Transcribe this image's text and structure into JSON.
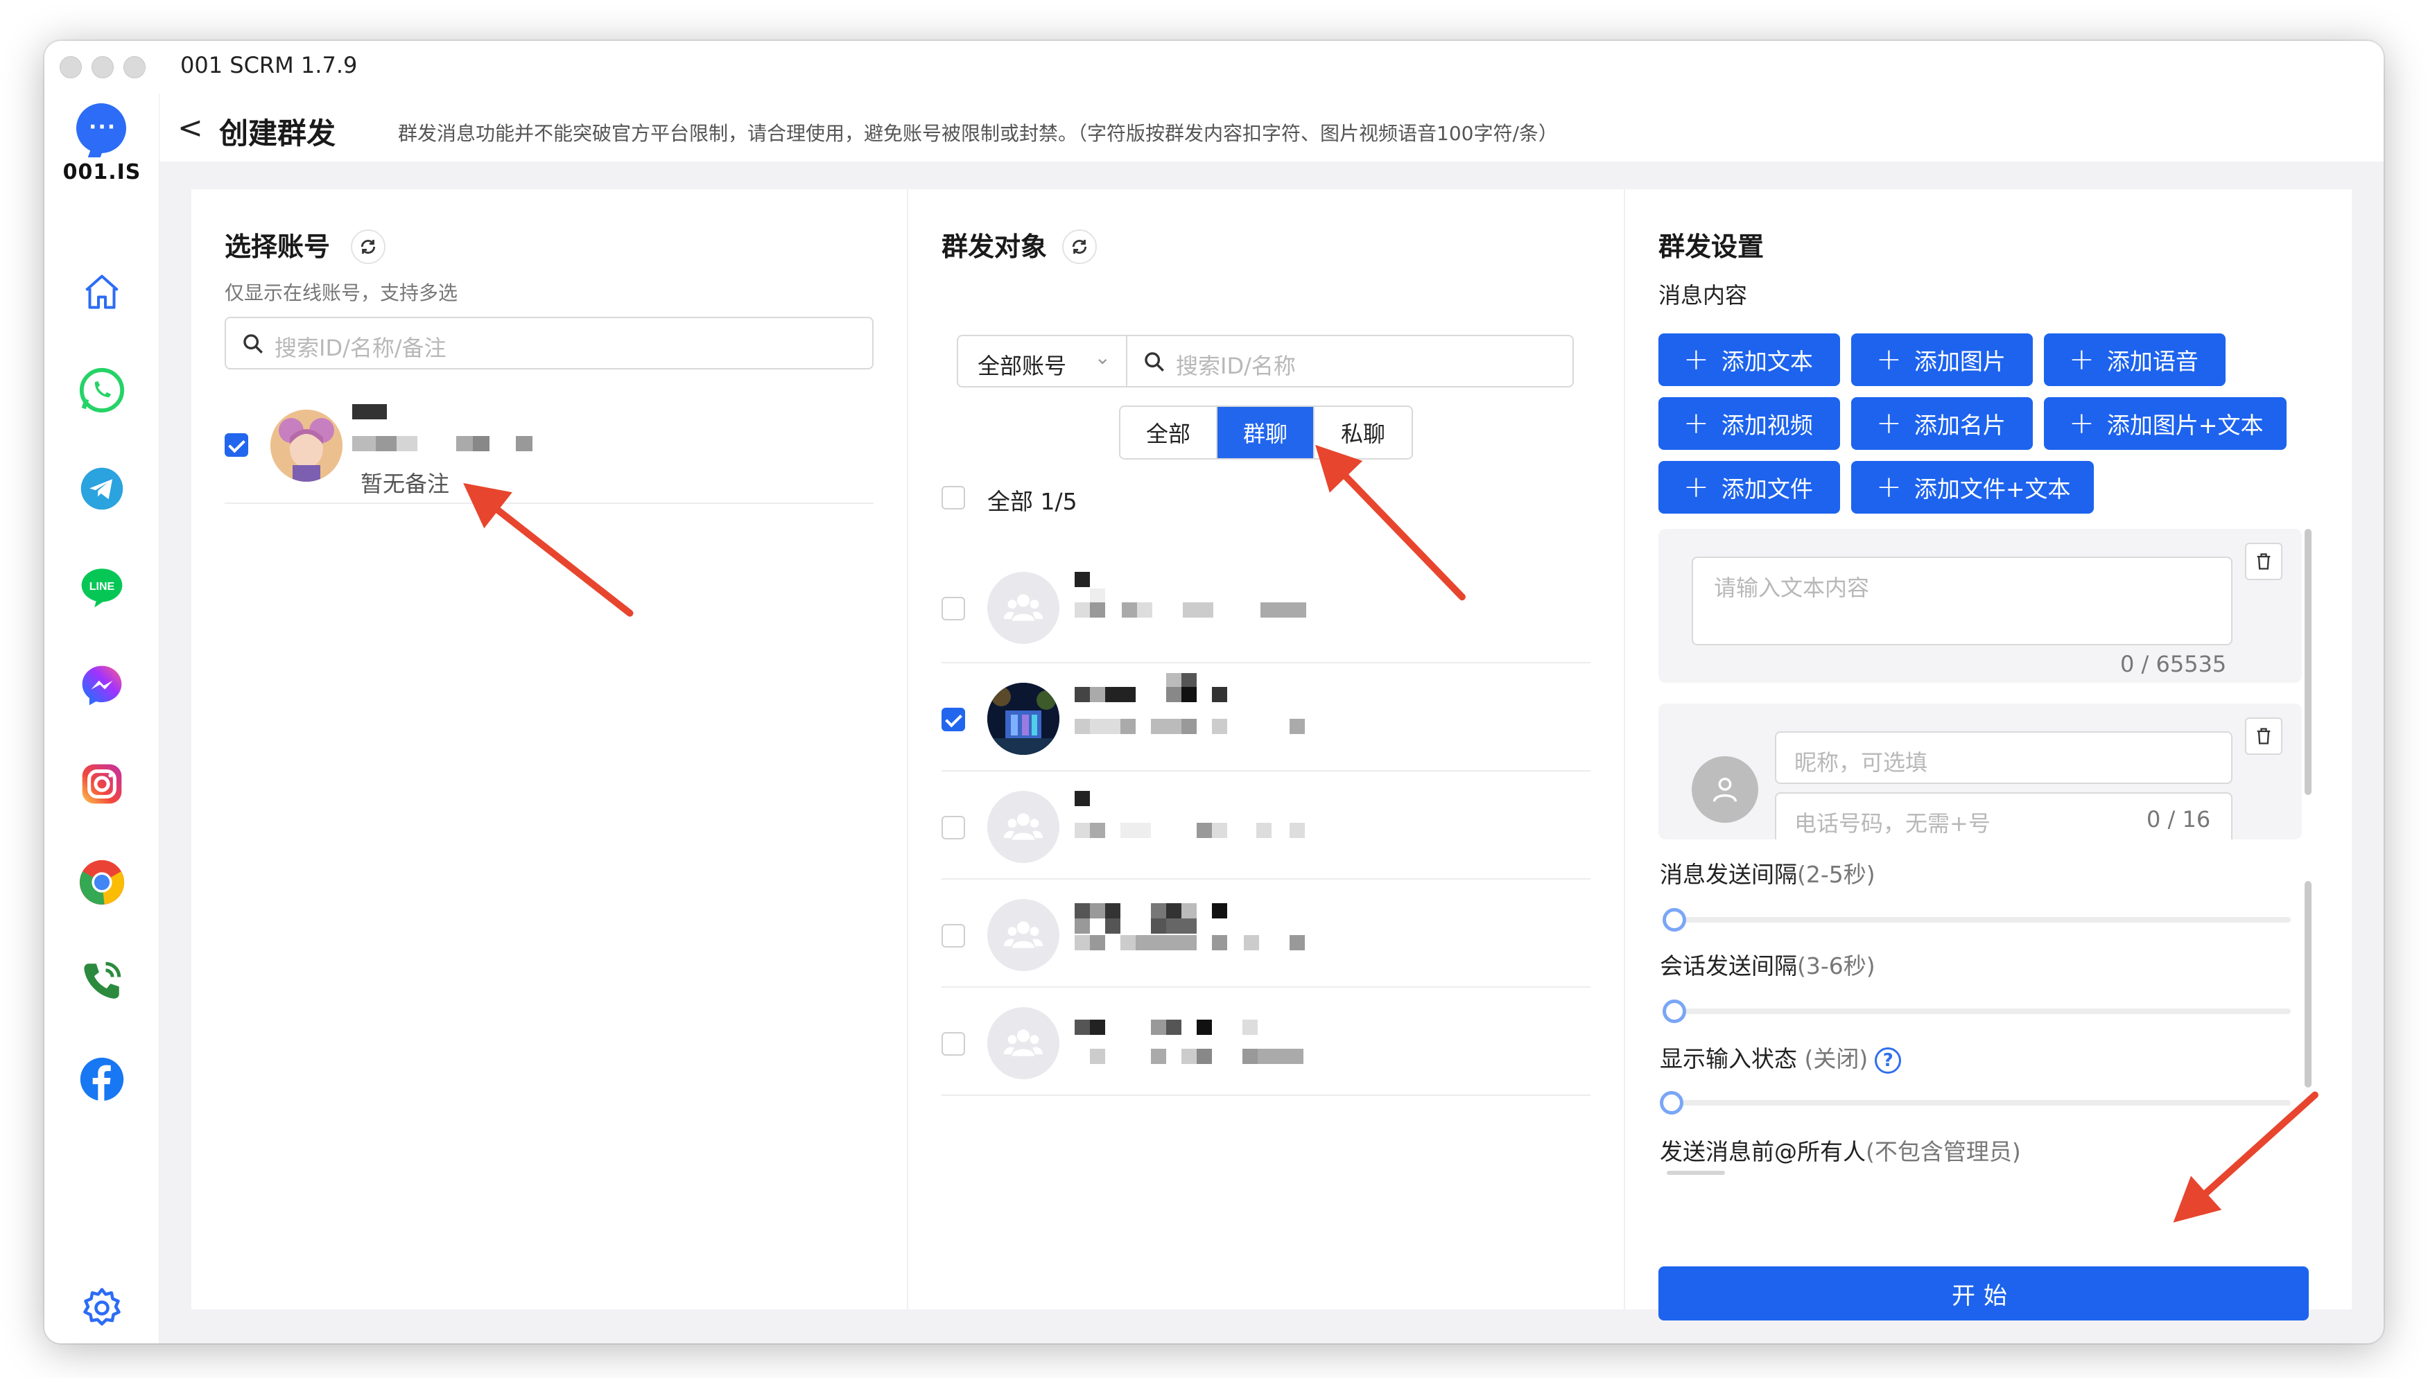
{
  "window": {
    "title": "001 SCRM 1.7.9"
  },
  "logo": {
    "text": "001.IS"
  },
  "sidebar": {
    "items": [
      {
        "name": "home",
        "icon": "home-icon"
      },
      {
        "name": "whatsapp",
        "icon": "whatsapp-icon"
      },
      {
        "name": "telegram",
        "icon": "telegram-icon"
      },
      {
        "name": "line",
        "icon": "line-icon",
        "label": "LINE"
      },
      {
        "name": "messenger",
        "icon": "messenger-icon"
      },
      {
        "name": "instagram",
        "icon": "instagram-icon"
      },
      {
        "name": "chrome",
        "icon": "chrome-icon"
      },
      {
        "name": "phone",
        "icon": "phone-icon"
      },
      {
        "name": "facebook",
        "icon": "facebook-icon"
      },
      {
        "name": "settings",
        "icon": "gear-icon"
      }
    ]
  },
  "header": {
    "back": "<",
    "title": "创建群发",
    "note": "群发消息功能并不能突破官方平台限制，请合理使用，避免账号被限制或封禁。（字符版按群发内容扣字符、图片视频语音100字符/条）"
  },
  "accounts": {
    "title": "选择账号",
    "hint": "仅显示在线账号，支持多选",
    "search_placeholder": "搜索ID/名称/备注",
    "items": [
      {
        "remark": "暂无备注",
        "checked": true
      }
    ]
  },
  "targets": {
    "title": "群发对象",
    "filter_value": "全部账号",
    "search_placeholder": "搜索ID/名称",
    "tabs": [
      "全部",
      "群聊",
      "私聊"
    ],
    "active_tab": "群聊",
    "select_all_label": "全部 1/5",
    "items": [
      {
        "checked": false,
        "avatar": "group"
      },
      {
        "checked": true,
        "avatar": "photo"
      },
      {
        "checked": false,
        "avatar": "group"
      },
      {
        "checked": false,
        "avatar": "group"
      },
      {
        "checked": false,
        "avatar": "group"
      }
    ]
  },
  "settings": {
    "title": "群发设置",
    "content_label": "消息内容",
    "add_buttons": [
      "添加文本",
      "添加图片",
      "添加语音",
      "添加视频",
      "添加名片",
      "添加图片+文本",
      "添加文件",
      "添加文件+文本"
    ],
    "text_placeholder": "请输入文本内容",
    "text_counter": "0 / 65535",
    "nickname_placeholder": "昵称，可选填",
    "phone_placeholder": "电话号码，无需+号",
    "phone_counter": "0 / 16",
    "msg_interval_label": "消息发送间隔",
    "msg_interval_range": "(2-5秒)",
    "conv_interval_label": "会话发送间隔",
    "conv_interval_range": "(3-6秒)",
    "typing_label": "显示输入状态",
    "typing_state": "(关闭)",
    "help": "?",
    "at_all_label": "发送消息前@所有人",
    "at_all_note": "(不包含管理员)",
    "start_button": "开始"
  }
}
